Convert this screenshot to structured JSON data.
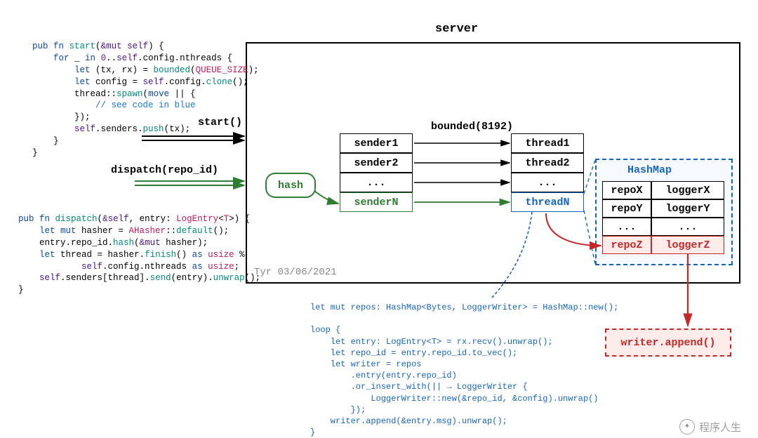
{
  "title": "server",
  "labels": {
    "start": "start()",
    "dispatch": "dispatch(repo_id)",
    "bounded": "bounded(8192)",
    "hash": "hash",
    "hashmap": "HashMap",
    "writer_append": "writer.append()",
    "attribution": "Tyr 03/06/2021"
  },
  "senders": [
    "sender1",
    "sender2",
    "...",
    "senderN"
  ],
  "threads": [
    "thread1",
    "thread2",
    "...",
    "threadN"
  ],
  "hashmap_rows": [
    {
      "repo": "repoX",
      "logger": "loggerX"
    },
    {
      "repo": "repoY",
      "logger": "loggerY"
    },
    {
      "repo": "...",
      "logger": "..."
    },
    {
      "repo": "repoZ",
      "logger": "loggerZ"
    }
  ],
  "code_start": "pub fn start(&mut self) {\n    for _ in 0..self.config.nthreads {\n        let (tx, rx) = bounded(QUEUE_SIZE);\n        let config = self.config.clone();\n        thread::spawn(move || {\n            // see code in blue\n        });\n        self.senders.push(tx);\n    }\n}",
  "code_dispatch": "pub fn dispatch(&self, entry: LogEntry<T>) {\n    let mut hasher = AHasher::default();\n    entry.repo_id.hash(&mut hasher);\n    let thread = hasher.finish() as usize %\n            self.config.nthreads as usize;\n    self.senders[thread].send(entry).unwrap();\n}",
  "code_thread": "let mut repos: HashMap<Bytes, LoggerWriter> = HashMap::new();\n\nloop {\n    let entry: LogEntry<T> = rx.recv().unwrap();\n    let repo_id = entry.repo_id.to_vec();\n    let writer = repos\n        .entry(entry.repo_id)\n        .or_insert_with(|| → LoggerWriter {\n            LoggerWriter::new(&repo_id, &config).unwrap()\n        });\n    writer.append(&entry.msg).unwrap();\n}",
  "watermark": "程序人生"
}
